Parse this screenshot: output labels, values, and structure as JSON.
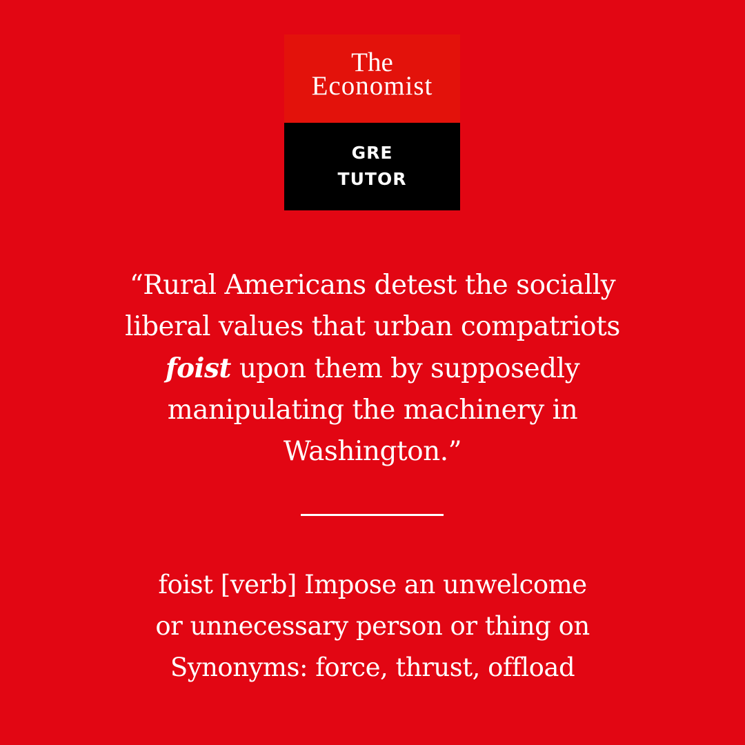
{
  "brand": {
    "name_line1": "The",
    "name_line2": "Economist",
    "product_line1": "GRE",
    "product_line2": "TUTOR",
    "colors": {
      "background": "#e20613",
      "logo_red": "#e3120b",
      "logo_black": "#000000",
      "text": "#ffffff"
    }
  },
  "quote": {
    "line1": "“Rural Americans detest the socially",
    "line2": "liberal values that urban compatriots",
    "keyword": "foist",
    "line3_rest": " upon them by supposedly",
    "line4": "manipulating the machinery in",
    "line5": "Washington.”"
  },
  "definition": {
    "line1": "foist [verb] Impose an unwelcome",
    "line2": "or unnecessary person or thing on",
    "line3": "Synonyms: force, thrust, offload"
  }
}
